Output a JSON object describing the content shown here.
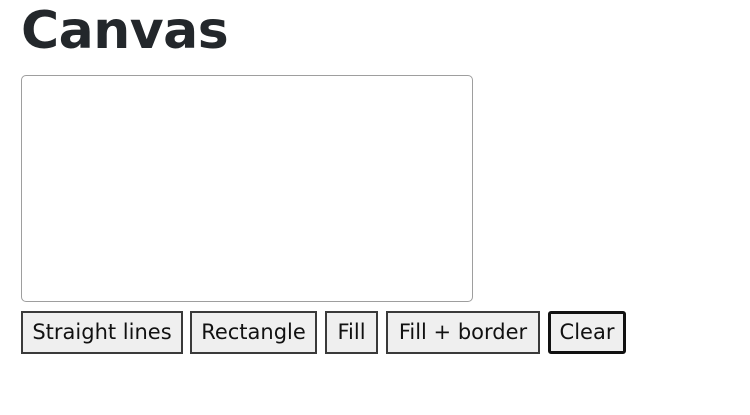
{
  "page": {
    "title": "Canvas"
  },
  "toolbar": {
    "straight_lines_label": "Straight lines",
    "rectangle_label": "Rectangle",
    "fill_label": "Fill",
    "fill_border_label": "Fill + border",
    "clear_label": "Clear",
    "active_tool": "Clear"
  },
  "colors": {
    "canvas_border": "#9e9e9e",
    "button_background": "#efefef",
    "button_border": "#3a3a3a",
    "title_text": "#23272b"
  }
}
